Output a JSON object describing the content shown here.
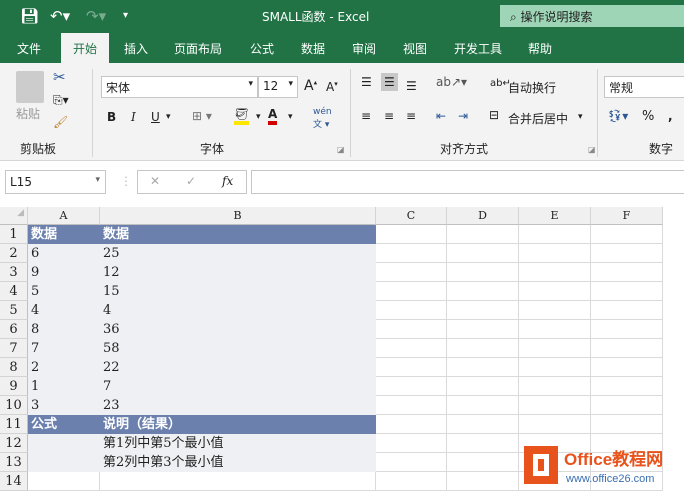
{
  "titlebar": {
    "title": "SMALL函数  -  Excel",
    "search": "操作说明搜索"
  },
  "tabs": [
    "文件",
    "开始",
    "插入",
    "页面布局",
    "公式",
    "数据",
    "审阅",
    "视图",
    "开发工具",
    "帮助"
  ],
  "ribbon": {
    "paste": "粘贴",
    "clipboard": "剪贴板",
    "font_name": "宋体",
    "font_size": "12",
    "font_group": "字体",
    "wrap": "自动换行",
    "merge": "合并后居中",
    "align_group": "对齐方式",
    "number_format": "常规",
    "number_group": "数字",
    "bold": "B",
    "italic": "I",
    "underline": "U",
    "percent": "%",
    "comma": ","
  },
  "formula_bar": {
    "name_box": "L15",
    "fx": "fx",
    "value": ""
  },
  "columns": [
    "A",
    "B",
    "C",
    "D",
    "E",
    "F"
  ],
  "rows": [
    [
      "数据",
      "数据"
    ],
    [
      "6",
      "25"
    ],
    [
      "9",
      "12"
    ],
    [
      "5",
      "15"
    ],
    [
      "4",
      "4"
    ],
    [
      "8",
      "36"
    ],
    [
      "7",
      "58"
    ],
    [
      "2",
      "22"
    ],
    [
      "1",
      "7"
    ],
    [
      "3",
      "23"
    ],
    [
      "公式",
      "说明（结果）"
    ],
    [
      "",
      "第1列中第5个最小值"
    ],
    [
      "",
      "第2列中第3个最小值"
    ],
    [
      "",
      ""
    ]
  ],
  "watermark": {
    "name": "Office教程网",
    "url": "www.office26.com"
  },
  "colors": {
    "accent": "#217346",
    "header_fill": "#6b80ad",
    "data_fill": "#eef0f3"
  }
}
